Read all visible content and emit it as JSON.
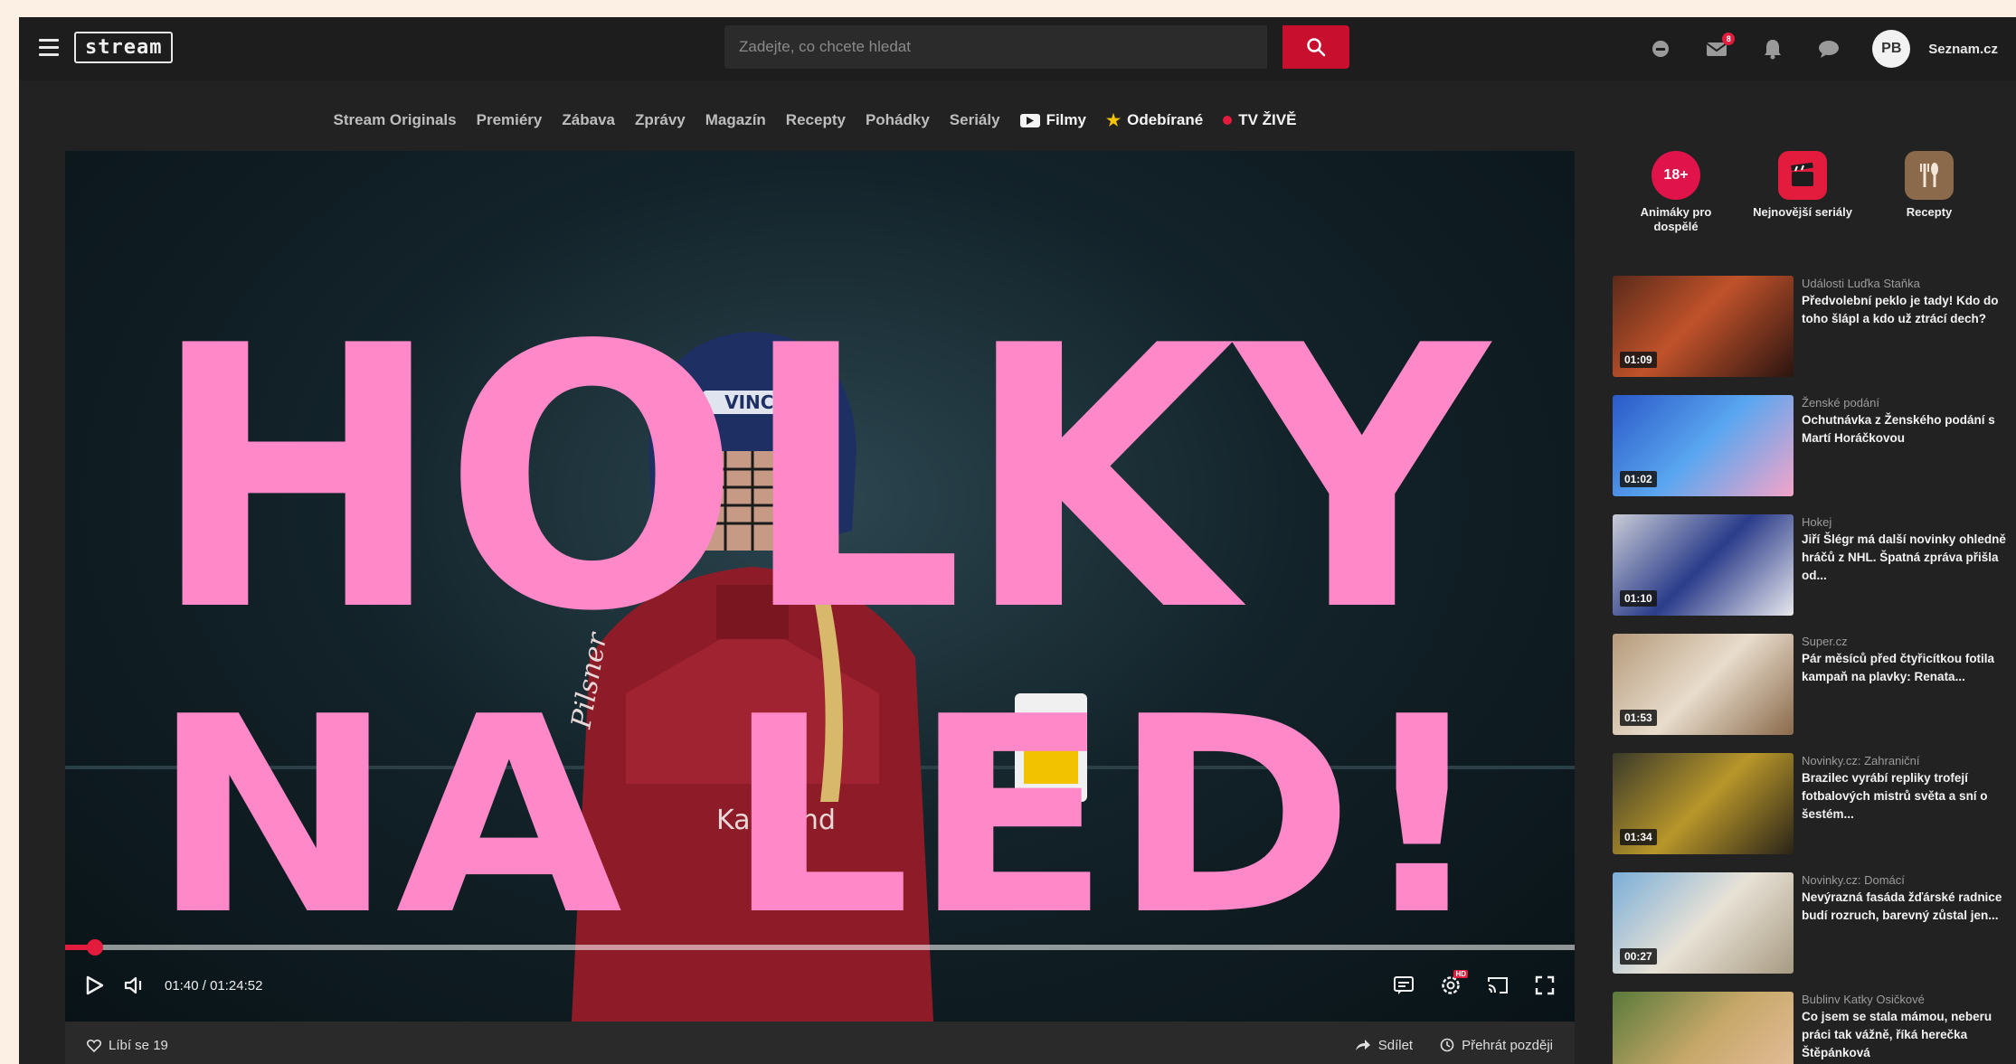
{
  "header": {
    "logo": "stream",
    "search_placeholder": "Zadejte, co chcete hledat",
    "mail_badge": "8",
    "avatar_initials": "PB",
    "account_label": "Seznam.cz"
  },
  "nav": {
    "items": [
      "Stream Originals",
      "Premiéry",
      "Zábava",
      "Zprávy",
      "Magazín",
      "Recepty",
      "Pohádky",
      "Seriály"
    ],
    "films": "Filmy",
    "subscribed": "Odebírané",
    "live": "TV ŽIVĚ"
  },
  "video": {
    "title_line1": "HOLKY",
    "title_line2": "NA LED!",
    "helmet_text": "VINCI",
    "jersey_text": "Pilsner",
    "jersey_sponsor": "Kaufland",
    "current_time": "01:40",
    "total_time": "01:24:52",
    "progress": 0.02,
    "hd_label": "HD",
    "colors": {
      "accent": "#e31b3c",
      "title_pink": "#ff88c8"
    }
  },
  "actions": {
    "like": "Líbí se 19",
    "share": "Sdílet",
    "watch_later": "Přehrát později"
  },
  "sidebar": {
    "shortcuts": [
      {
        "label": "Animáky pro dospělé",
        "icon_text": "18+",
        "color": "#e0144a"
      },
      {
        "label": "Nejnovější seriály",
        "icon_text": "",
        "color": "#e31b3c"
      },
      {
        "label": "Recepty",
        "icon_text": "",
        "color": "#8a6a4a"
      }
    ],
    "videos": [
      {
        "source": "Události Luďka Staňka",
        "title": "Předvolební peklo je tady! Kdo do toho šlápl a kdo už ztrácí dech?",
        "duration": "01:09",
        "bg": "linear-gradient(135deg,#5a2a1a,#c0522a 45%,#2b1410)"
      },
      {
        "source": "Ženské podání",
        "title": "Ochutnávka z Ženského podání s Martí Horáčkovou",
        "duration": "01:02",
        "bg": "linear-gradient(135deg,#2a59c8,#5aa6f0 50%,#f4a4c8)"
      },
      {
        "source": "Hokej",
        "title": "Jiří Šlégr má další novinky ohledně hráčů z NHL. Špatná zpráva přišla od...",
        "duration": "01:10",
        "bg": "linear-gradient(135deg,#c9ccd6,#2b3c8a 50%,#e8e8ee)"
      },
      {
        "source": "Super.cz",
        "title": "Pár měsíců před čtyřicítkou fotila kampaň na plavky: Renata...",
        "duration": "01:53",
        "bg": "linear-gradient(135deg,#b59a7a,#e8dccc 50%,#8a6a4a)"
      },
      {
        "source": "Novinky.cz: Zahraniční",
        "title": "Brazilec vyrábí repliky trofejí fotbalových mistrů světa a sní o šestém...",
        "duration": "01:34",
        "bg": "linear-gradient(135deg,#3a3a2a,#b8962a 50%,#2a2418)"
      },
      {
        "source": "Novinky.cz: Domácí",
        "title": "Nevýrazná fasáda žďárské radnice budí rozruch, barevný zůstal jen...",
        "duration": "00:27",
        "bg": "linear-gradient(135deg,#7aaed8,#e8e2d6 50%,#a89a82)"
      },
      {
        "source": "Bublinv Katky Osičkové",
        "title": "Co jsem se stala mámou, neberu práci tak vážně, říká herečka Štěpánková",
        "duration": "",
        "bg": "linear-gradient(135deg,#5a7a3a,#c8a86a 50%,#e8c0a0)"
      }
    ]
  }
}
